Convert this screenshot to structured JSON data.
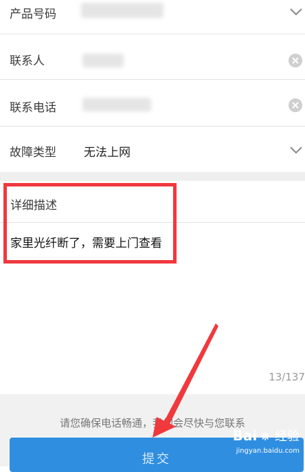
{
  "form": {
    "product_number": {
      "label": "产品号码"
    },
    "contact": {
      "label": "联系人"
    },
    "phone": {
      "label": "联系电话"
    },
    "fault_type": {
      "label": "故障类型",
      "value": "无法上网"
    }
  },
  "description": {
    "title": "详细描述",
    "text": "家里光纤断了，需要上门查看",
    "counter": "13/137"
  },
  "footer": {
    "notice": "请您确保电话畅通，我们会尽快与您联系",
    "submit_label": "提交"
  },
  "watermark": {
    "logo": "Bai",
    "logo_suffix": "经验",
    "url": "jingyan.baidu.com"
  },
  "colors": {
    "accent": "#2f8ee0",
    "highlight": "#f0393d"
  }
}
